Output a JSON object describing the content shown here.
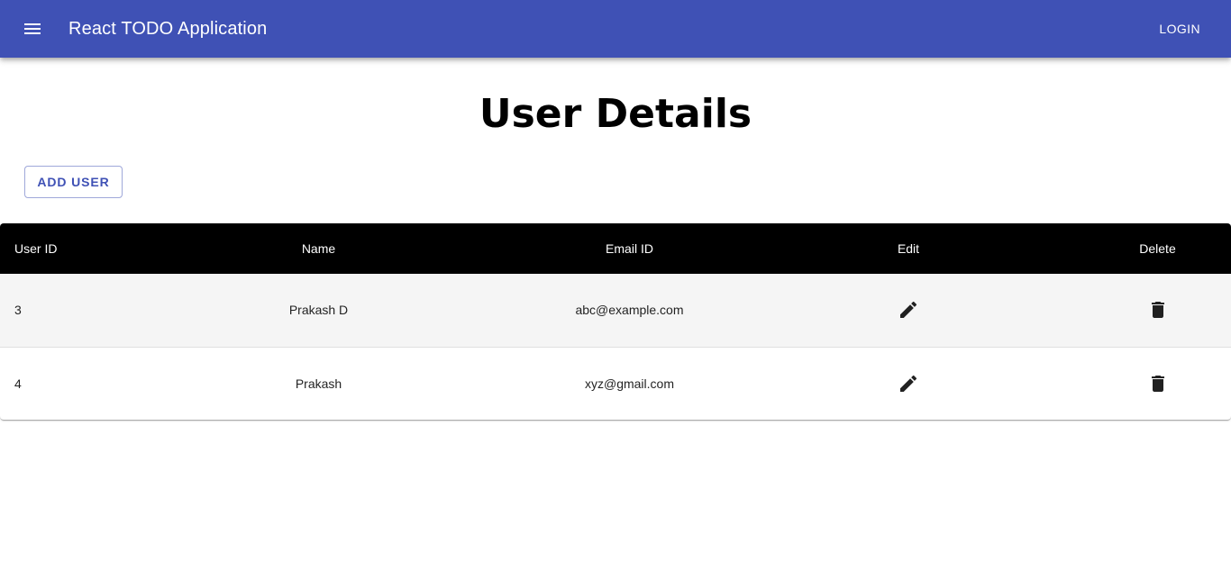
{
  "appbar": {
    "menu_icon": "menu-icon",
    "title": "React TODO Application",
    "login_label": "LOGIN",
    "background": "#3f51b5"
  },
  "main": {
    "heading": "User Details",
    "add_user_label": "ADD USER",
    "accent_color": "#3f51b5"
  },
  "table": {
    "headers": [
      "User ID",
      "Name",
      "Email ID",
      "Edit",
      "Delete"
    ],
    "rows": [
      {
        "id": "3",
        "name": "Prakash D",
        "email": "abc@example.com",
        "edit_icon": "pencil-icon",
        "delete_icon": "trash-icon"
      },
      {
        "id": "4",
        "name": "Prakash",
        "email": "xyz@gmail.com",
        "edit_icon": "pencil-icon",
        "delete_icon": "trash-icon"
      }
    ]
  }
}
